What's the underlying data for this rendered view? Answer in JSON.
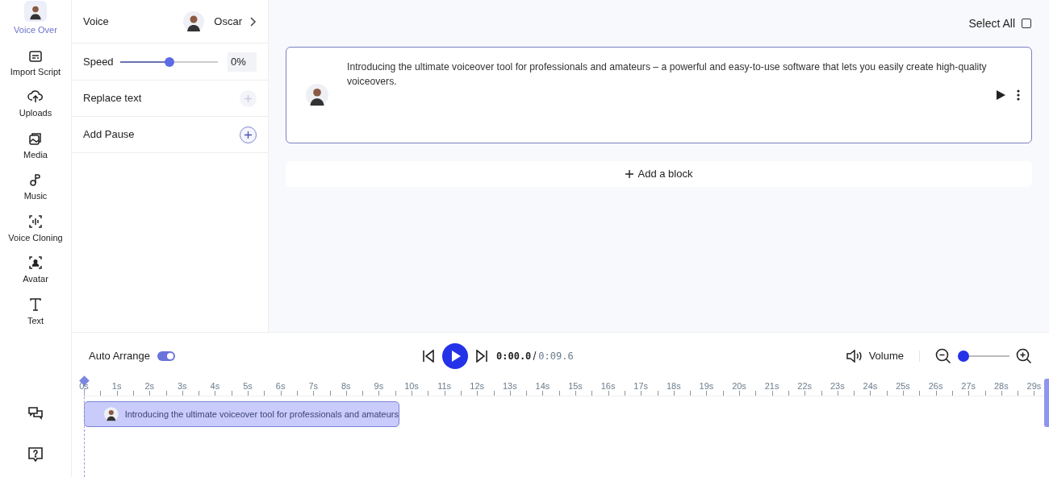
{
  "nav": [
    {
      "label": "Voice Over",
      "selected": true
    },
    {
      "label": "Import Script",
      "selected": false
    },
    {
      "label": "Uploads",
      "selected": false
    },
    {
      "label": "Media",
      "selected": false
    },
    {
      "label": "Music",
      "selected": false
    },
    {
      "label": "Voice Cloning",
      "selected": false
    },
    {
      "label": "Avatar",
      "selected": false
    },
    {
      "label": "Text",
      "selected": false
    }
  ],
  "settings": {
    "voice": {
      "label": "Voice",
      "value": "Oscar"
    },
    "speed": {
      "label": "Speed",
      "level": 0.5,
      "reading": "0%"
    },
    "options": [
      {
        "label": "Replace text",
        "disabled": true
      },
      {
        "label": "Add Pause",
        "disabled": false
      }
    ]
  },
  "select_all": {
    "label": "Select All",
    "checked": false
  },
  "blocks": [
    {
      "text": "Introducing the ultimate voiceover tool for professionals and amateurs – a powerful and easy-to-use software that lets you easily create high-quality voiceovers.",
      "selected": true
    }
  ],
  "add_block": {
    "label": "Add a block"
  },
  "timeline": {
    "auto_arrange": {
      "label": "Auto Arrange",
      "on": true
    },
    "current_time": "0:00.0",
    "total_time": "0:09.6",
    "volume": {
      "label": "Volume"
    },
    "zoom": {
      "level": 0
    },
    "ruler": [
      "0s",
      "1s",
      "2s",
      "3s",
      "4s",
      "5s",
      "6s",
      "7s",
      "8s",
      "9s",
      "10s",
      "11s",
      "12s",
      "13s",
      "14s",
      "15s",
      "16s",
      "17s",
      "18s",
      "19s",
      "20s",
      "21s",
      "22s",
      "23s",
      "24s",
      "25s",
      "26s",
      "27s",
      "28s",
      "29s"
    ],
    "clips": [
      {
        "text": "Introducing the ultimate voiceover tool for professionals and amateurs"
      }
    ]
  }
}
